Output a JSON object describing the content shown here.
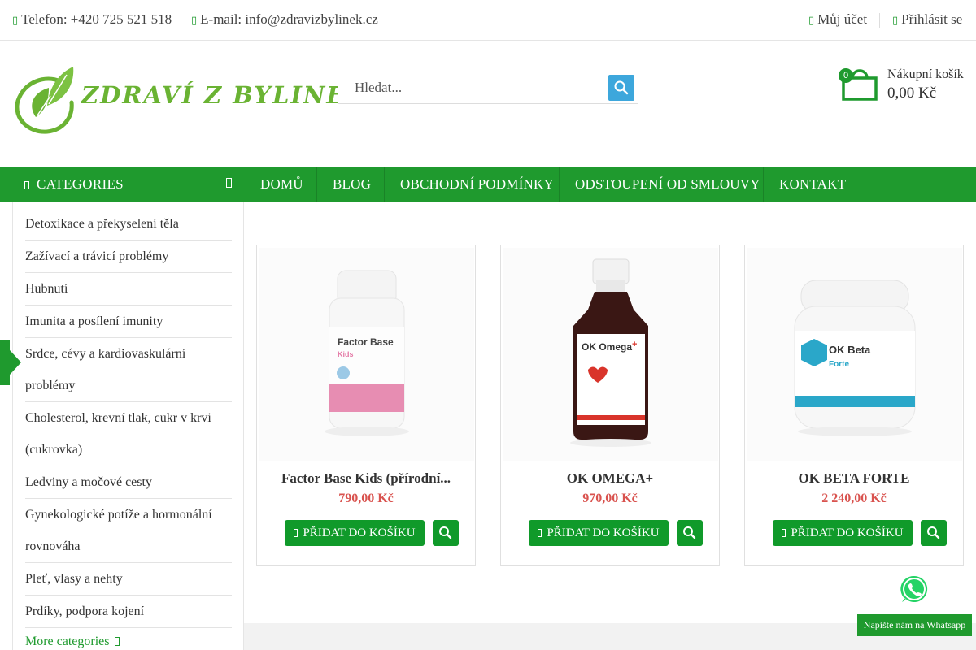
{
  "topbar": {
    "phone": "Telefon: +420 725 521 518",
    "email": "E-mail: info@zdravizbylinek.cz",
    "account": "Můj účet",
    "login": "Přihlásit se"
  },
  "header": {
    "logo_text": "ZDRAVÍ Z BYLINEK",
    "search_placeholder": "Hledat...",
    "cart_label": "Nákupní košík",
    "cart_amount": "0,00 Kč",
    "cart_count": "0"
  },
  "nav": {
    "categories_label": "CATEGORIES",
    "items": [
      "DOMŮ",
      "BLOG",
      "OBCHODNÍ PODMÍNKY",
      "ODSTOUPENÍ OD SMLOUVY",
      "KONTAKT"
    ]
  },
  "sidebar": {
    "items": [
      "Detoxikace a překyselení těla",
      "Zažívací a trávicí problémy",
      "Hubnutí",
      "Imunita a posílení imunity",
      "Srdce, cévy a kardiovaskulární problémy",
      "Cholesterol, krevní tlak, cukr v krvi (cukrovka)",
      "Ledviny a močové cesty",
      "Gynekologické potíže a hormonální rovnováha",
      "Pleť, vlasy a nehty",
      "Prdíky, podpora kojení"
    ],
    "more": "More categories"
  },
  "products": [
    {
      "name": "Factor Base Kids (přírodní...",
      "price": "790,00 Kč",
      "add_label": "PŘIDAT DO KOŠÍKU",
      "label_title": "Factor Base",
      "label_sub": "Kids",
      "accent": "#e47aa6"
    },
    {
      "name": "OK OMEGA+",
      "price": "970,00 Kč",
      "add_label": "PŘIDAT DO KOŠÍKU",
      "label_title": "OK Omega",
      "label_sub": "+",
      "accent": "#d9342b"
    },
    {
      "name": "OK BETA FORTE",
      "price": "2 240,00 Kč",
      "add_label": "PŘIDAT DO KOŠÍKU",
      "label_title": "OK Beta",
      "label_sub": "Forte",
      "accent": "#2aa7c9"
    }
  ],
  "whatsapp": {
    "chip": "Napište nám na Whatsapp"
  },
  "colors": {
    "brand_green": "#1f9a2e",
    "price_red": "#d9534f",
    "search_blue": "#3da7dc",
    "logo_green": "#6ab333"
  }
}
